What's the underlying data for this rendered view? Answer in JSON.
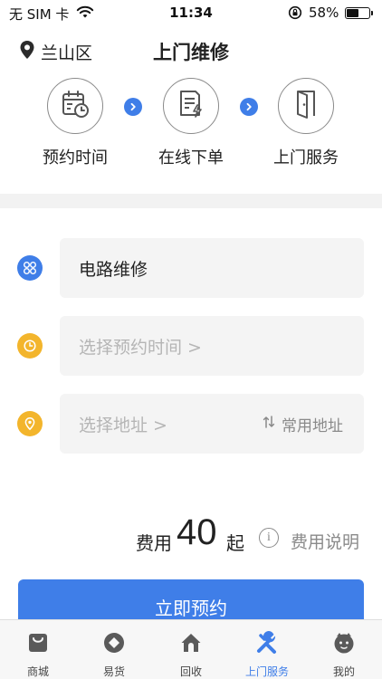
{
  "status_bar": {
    "carrier": "无 SIM 卡",
    "time": "11:34",
    "battery_percent": "58%",
    "battery_level": 0.58
  },
  "header": {
    "location": "兰山区",
    "title": "上门维修"
  },
  "steps": [
    {
      "label": "预约时间",
      "icon": "calendar-clock-icon"
    },
    {
      "label": "在线下单",
      "icon": "document-lightning-icon"
    },
    {
      "label": "上门服务",
      "icon": "door-icon"
    }
  ],
  "form": {
    "service": {
      "value": "电路维修",
      "icon": "grid-circles-icon",
      "color": "#3f7ee8"
    },
    "time": {
      "placeholder": "选择预约时间 >",
      "icon": "clock-icon",
      "color": "#f3b52c"
    },
    "address": {
      "placeholder": "选择地址 >",
      "common_label": "常用地址",
      "icon": "location-icon",
      "color": "#f3b52c"
    }
  },
  "fee": {
    "prefix": "费用",
    "amount": "40",
    "suffix": "起",
    "info_symbol": "i",
    "description": "费用说明"
  },
  "book_button": {
    "label": "立即预约"
  },
  "tabs": [
    {
      "label": "商城",
      "icon": "shopping-bag-icon",
      "active": false
    },
    {
      "label": "易货",
      "icon": "exchange-icon",
      "active": false
    },
    {
      "label": "回收",
      "icon": "home-icon",
      "active": false
    },
    {
      "label": "上门服务",
      "icon": "tools-icon",
      "active": true
    },
    {
      "label": "我的",
      "icon": "profile-icon",
      "active": false
    }
  ],
  "colors": {
    "accent": "#3f7ee8",
    "yellow": "#f3b52c",
    "text": "#222222",
    "muted": "#8a8a8a",
    "placeholder": "#b5b5b5",
    "field_bg": "#f4f4f4"
  }
}
